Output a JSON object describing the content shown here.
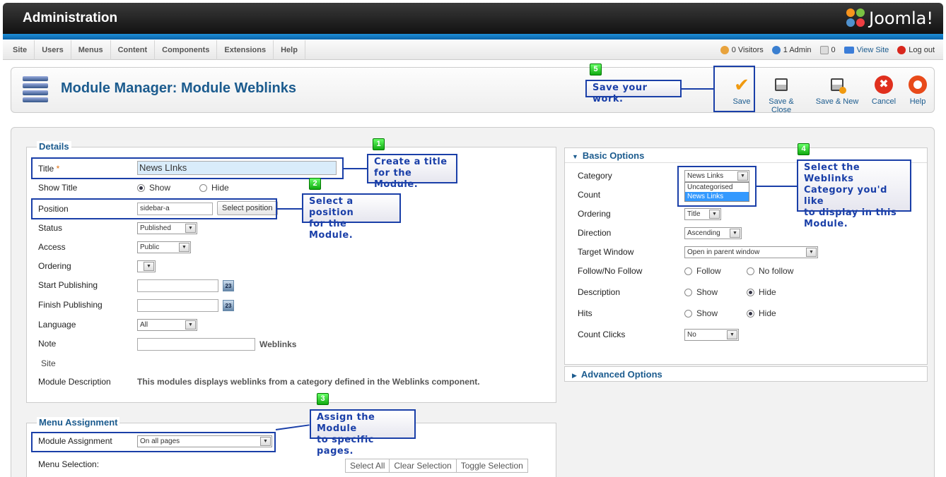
{
  "header": {
    "title": "Administration",
    "logo_text": "Joomla!"
  },
  "menu": {
    "items": [
      "Site",
      "Users",
      "Menus",
      "Content",
      "Components",
      "Extensions",
      "Help"
    ]
  },
  "status": {
    "visitors": "0 Visitors",
    "admins": "1 Admin",
    "messages": "0",
    "view_site": "View Site",
    "logout": "Log out"
  },
  "toolbar": {
    "page_title": "Module Manager: Module Weblinks",
    "save": "Save",
    "save_close": "Save & Close",
    "save_new": "Save & New",
    "cancel": "Cancel",
    "help": "Help"
  },
  "details": {
    "legend": "Details",
    "title_label": "Title",
    "title_required": "*",
    "title_value": "News LInks",
    "show_title_label": "Show Title",
    "show_option": "Show",
    "hide_option": "Hide",
    "position_label": "Position",
    "position_value": "sidebar-a",
    "select_position": "Select position",
    "status_label": "Status",
    "status_value": "Published",
    "access_label": "Access",
    "access_value": "Public",
    "ordering_label": "Ordering",
    "ordering_value": "",
    "start_label": "Start Publishing",
    "finish_label": "Finish Publishing",
    "cal_text": "23",
    "language_label": "Language",
    "language_value": "All",
    "note_label": "Note",
    "note_value": "",
    "weblinks": "Weblinks",
    "site": "Site",
    "desc_label": "Module Description",
    "desc_value": "This modules displays weblinks from a category defined in the Weblinks component."
  },
  "menu_assignment": {
    "legend": "Menu Assignment",
    "assignment_label": "Module Assignment",
    "assignment_value": "On all pages",
    "selection_label": "Menu Selection:",
    "select_all": "Select All",
    "clear_selection": "Clear Selection",
    "toggle_selection": "Toggle Selection"
  },
  "basic_options": {
    "header": "Basic Options",
    "category_label": "Category",
    "category_value": "News Links",
    "category_options": [
      "Uncategorised",
      "News Links"
    ],
    "count_label": "Count",
    "ordering_label": "Ordering",
    "ordering_value": "Title",
    "direction_label": "Direction",
    "direction_value": "Ascending",
    "target_label": "Target Window",
    "target_value": "Open in parent window",
    "follow_label": "Follow/No Follow",
    "follow": "Follow",
    "nofollow": "No follow",
    "description_label": "Description",
    "hits_label": "Hits",
    "show": "Show",
    "hide": "Hide",
    "count_clicks_label": "Count Clicks",
    "count_clicks_value": "No"
  },
  "advanced_options": {
    "header": "Advanced Options"
  },
  "callouts": {
    "c1_num": "1",
    "c1_line1": "Create a title",
    "c1_line2": "for the Module.",
    "c2_num": "2",
    "c2_line1": "Select a position",
    "c2_line2": "for the Module.",
    "c3_num": "3",
    "c3_line1": "Assign the Module",
    "c3_line2": "to specific pages.",
    "c4_num": "4",
    "c4_line1": "Select the Weblinks",
    "c4_line2": "Category you'd like",
    "c4_line3": "to display in this",
    "c4_line4": "Module.",
    "c5_num": "5",
    "c5_line1": "Save your work."
  }
}
